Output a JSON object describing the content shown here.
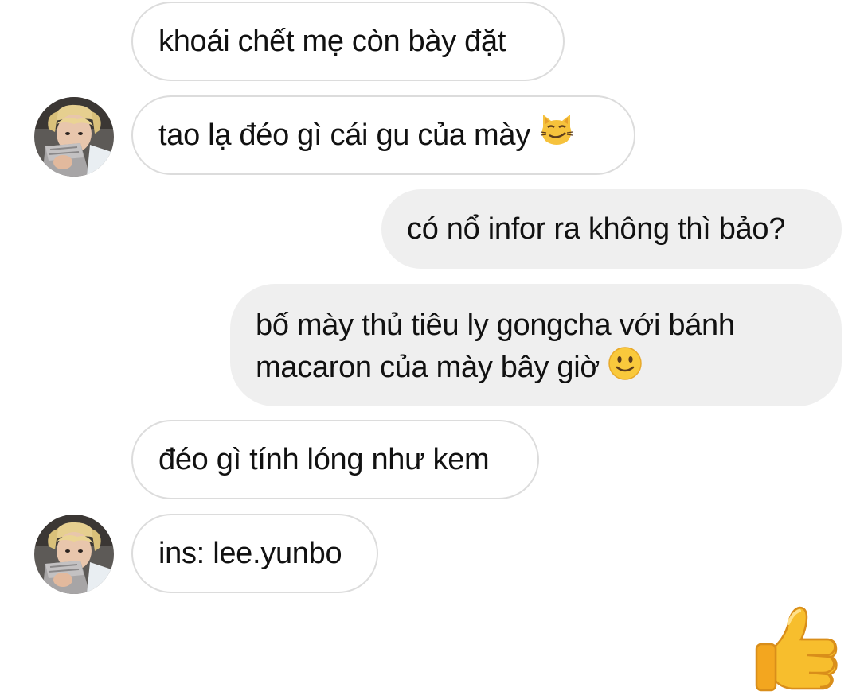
{
  "conversation": {
    "messages": [
      {
        "sender": "them",
        "text": "khoái chết mẹ còn bày đặt"
      },
      {
        "sender": "them",
        "text": "tao lạ đéo gì cái gu của mày",
        "emoji": "smirking-cat-icon"
      },
      {
        "sender": "me",
        "text": "có nổ infor ra không thì bảo?"
      },
      {
        "sender": "me",
        "lines": [
          "bố mày thủ tiêu ly gongcha với bánh",
          "macaron của mày bây giờ"
        ],
        "emoji": "slightly-smiling-face-icon"
      },
      {
        "sender": "them",
        "text": "đéo gì tính lóng như kem"
      },
      {
        "sender": "them",
        "text": "ins: lee.yunbo"
      }
    ],
    "like_icon": "thumbs-up-icon",
    "colors": {
      "incoming_border": "#dcdcdc",
      "outgoing_bg": "#efefef",
      "text": "#111111"
    }
  }
}
